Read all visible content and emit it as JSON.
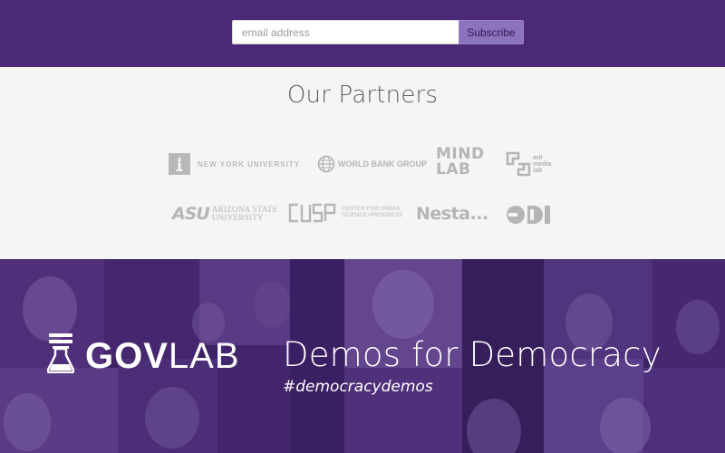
{
  "subscribe": {
    "email_placeholder": "email address",
    "button_label": "Subscribe"
  },
  "partners": {
    "title": "Our Partners",
    "logos": {
      "nyu": "NEW YORK UNIVERSITY",
      "world_bank": "WORLD BANK GROUP",
      "mind_lab_line1": "MIND",
      "mind_lab_line2": "LAB",
      "mit_line1": "mit",
      "mit_line2": "media",
      "mit_line3": "lab",
      "asu_mark": "ASU",
      "asu_line1": "ARIZONA STATE",
      "asu_line2": "UNIVERSITY",
      "cusp_mark": "CUSP",
      "cusp_line1": "CENTER FOR URBAN",
      "cusp_line2": "SCIENCE+PROGRESS",
      "nesta": "Nesta...",
      "odi": "ODI"
    }
  },
  "hero": {
    "brand_bold": "GOV",
    "brand_light": "LAB",
    "title": "Demos for Democracy",
    "hashtag": "#democracydemos"
  },
  "colors": {
    "header_purple": "#4a2a78",
    "button_purple": "#8d72bd",
    "hero_purple": "#3e2466",
    "partners_bg": "#f5f5f5",
    "logo_gray": "#b5b5b5"
  }
}
